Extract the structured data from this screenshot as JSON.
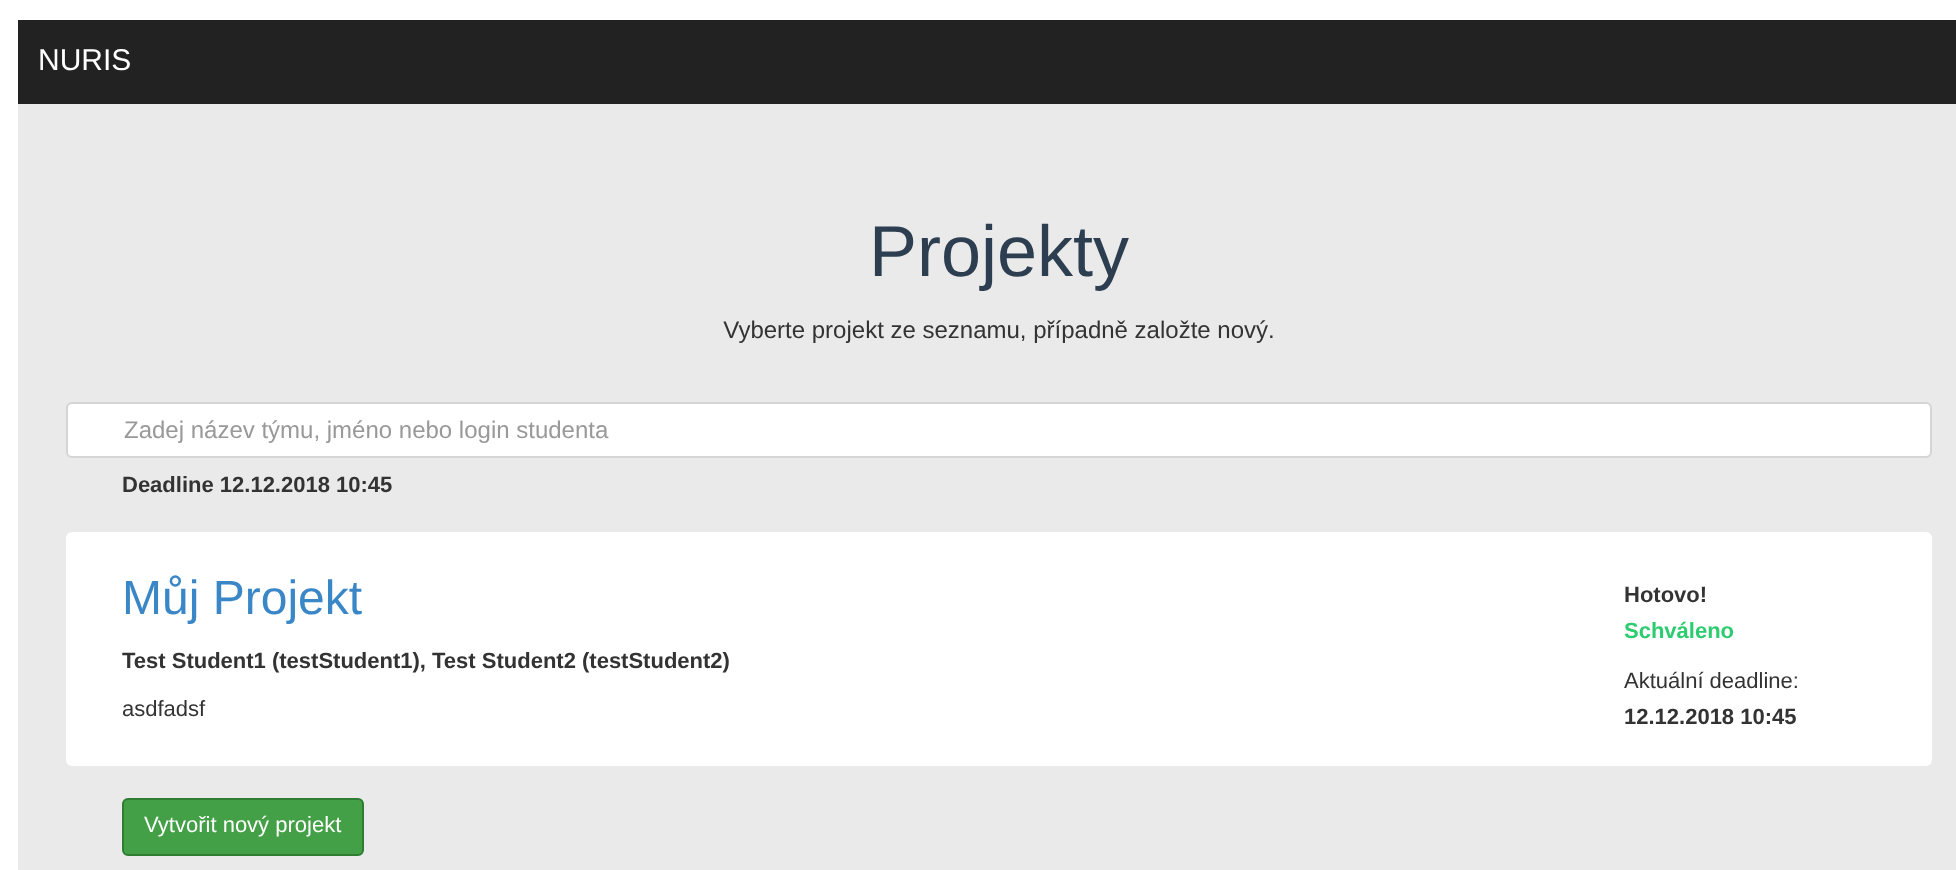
{
  "navbar": {
    "brand": "NURIS"
  },
  "header": {
    "title": "Projekty",
    "subtitle": "Vyberte projekt ze seznamu, případně založte nový."
  },
  "search": {
    "placeholder": "Zadej název týmu, jméno nebo login studenta"
  },
  "deadline": "Deadline 12.12.2018 10:45",
  "projects": [
    {
      "title": "Můj Projekt",
      "members": "Test Student1 (testStudent1), Test Student2 (testStudent2)",
      "description": "asdfadsf",
      "done_label": "Hotovo!",
      "status": {
        "label": "Schváleno",
        "kind": "approved"
      },
      "deadline_label": "Aktuální deadline:",
      "deadline": "12.12.2018 10:45"
    }
  ],
  "create_button": "Vytvořit nový projekt"
}
